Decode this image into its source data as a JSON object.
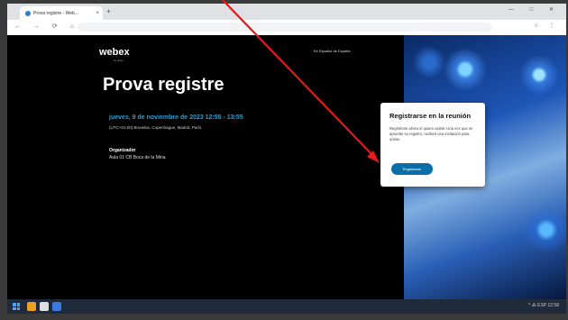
{
  "browser": {
    "tab_title": "Prova registre - Web...",
    "tab_close": "×",
    "newtab": "+",
    "window_controls": "— □ ✕",
    "nav": "← → ⟳ ⌂",
    "url": "",
    "extensions": "☆ ⋮"
  },
  "page": {
    "logo": "webex",
    "logo_sub": "by cisco",
    "language": "Es Español de España",
    "title": "Prova registre",
    "date": "jueves, 9 de noviembre de 2023 12:55 - 13:55",
    "timezone": "(UTC+01:00) Bruselas, Copenhague, Madrid, París",
    "organizer_label": "Organizador",
    "organizer_name": "Aula 01 CB Boca de la Mina"
  },
  "card": {
    "heading": "Registrarse en la reunión",
    "text": "Regístrese ahora si quiere asistir. Una vez que se apruebe su registro, recibirá una invitación para unirse.",
    "button": "Registrarse"
  },
  "taskbar": {
    "tray": "^ ⁂ ESP 12:58"
  },
  "colors": {
    "accent": "#1fa1e0",
    "button": "#0a6fa6",
    "arrow": "#e31b1b"
  }
}
